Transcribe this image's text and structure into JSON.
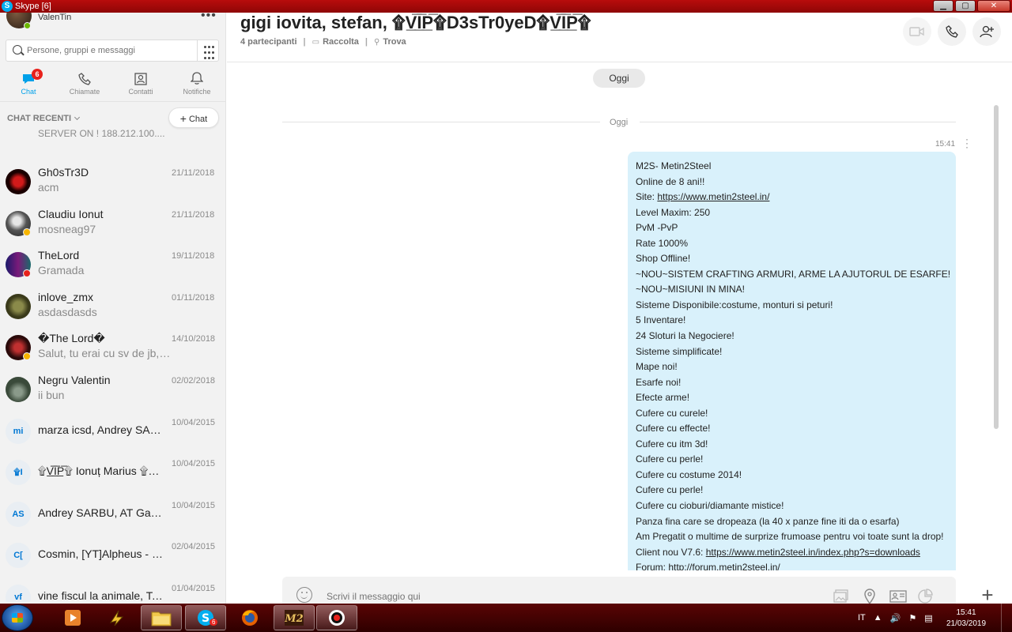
{
  "window": {
    "title": "Skype [6]",
    "icon": "skype-icon",
    "buttons": [
      "minimize",
      "maximize",
      "close"
    ]
  },
  "profile": {
    "name": "ValenTin",
    "presence": "online"
  },
  "search": {
    "placeholder": "Persone, gruppi e messaggi"
  },
  "nav_tabs": [
    {
      "label": "Chat",
      "icon": "chat-icon",
      "badge": "6",
      "active": true
    },
    {
      "label": "Chiamate",
      "icon": "phone-icon"
    },
    {
      "label": "Contatti",
      "icon": "contacts-icon"
    },
    {
      "label": "Notifiche",
      "icon": "bell-icon"
    }
  ],
  "recent": {
    "header": "CHAT RECENTI",
    "new_chat": "Chat"
  },
  "chat_list_cut_text": "SERVER ON ! 188.212.100....",
  "chats": [
    {
      "name": "Gh0sTr3D",
      "msg": "acm",
      "date": "21/11/2018",
      "avatar": "",
      "color": "#8b1010"
    },
    {
      "name": "Claudiu Ionut",
      "msg": "mosneag97",
      "date": "21/11/2018",
      "avatar": "",
      "color": "#5a5a5a",
      "status": "#f7b500"
    },
    {
      "name": "TheLord",
      "msg": "Gramada",
      "date": "19/11/2018",
      "avatar": "",
      "color": "#1a1a4a",
      "status": "#e8221c"
    },
    {
      "name": "inlove_zmx",
      "msg": "asdasdasds",
      "date": "01/11/2018",
      "avatar": "",
      "color": "#4a4a2a"
    },
    {
      "name": "�The Lord�",
      "msg": "Salut, tu erai cu sv de jb, pa...",
      "date": "14/10/2018",
      "avatar": "",
      "color": "#6a1010",
      "status": "#f7b500"
    },
    {
      "name": "Negru Valentin",
      "msg": "ii bun",
      "date": "02/02/2018",
      "avatar": "",
      "color": "#3a4a3a"
    },
    {
      "name": "marza icsd, Andrey SARB...",
      "msg": "",
      "date": "10/04/2015",
      "avatar": "mi"
    },
    {
      "name": "۩V̲̅I̲̅P̲̅۩ Ionuț Marius ۩V̲̅I̲̅P̲̅...",
      "msg": "",
      "date": "10/04/2015",
      "avatar": "۩I"
    },
    {
      "name": "Andrey SARBU, AT GabyRO",
      "msg": "",
      "date": "10/04/2015",
      "avatar": "AS"
    },
    {
      "name": "Cosmin, [YT]Alpheus - Fr...",
      "msg": "",
      "date": "02/04/2015",
      "avatar": "C["
    },
    {
      "name": "vine fiscul la animale, Tof...",
      "msg": "",
      "date": "01/04/2015",
      "avatar": "vf"
    }
  ],
  "conversation": {
    "title": "gigi iovita, stefan, ۩V̲̅I̲̅P̲̅۩D3sTr0yeD۩V̲̅I̲̅P̲̅۩",
    "participants": "4 partecipanti",
    "gallery": "Raccolta",
    "find": "Trova",
    "date_pill": "Oggi",
    "date_separator": "Oggi",
    "message_time": "15:41",
    "composer_placeholder": "Scrivi il messaggio qui"
  },
  "message_lines": [
    "M2S- Metin2Steel",
    "Online de 8 ani!!",
    "Site: https://www.metin2steel.in/",
    "Level Maxim: 250",
    "PvM -PvP",
    "Rate 1000%",
    "Shop Offline!",
    "~NOU~SISTEM CRAFTING ARMURI, ARME LA AJUTORUL DE ESARFE!",
    "~NOU~MISIUNI IN MINA!",
    "Sisteme Disponibile:costume, monturi si peturi!",
    "5 Inventare!",
    "24 Sloturi la Negociere!",
    "Sisteme simplificate!",
    "Mape noi!",
    "Esarfe noi!",
    "Efecte arme!",
    "Cufere cu curele!",
    "Cufere cu effecte!",
    "Cufere cu itm 3d!",
    "Cufere cu perle!",
    "Cufere cu costume 2014!",
    "Cufere cu perle!",
    "Cufere cu cioburi/diamante mistice!",
    "Panza fina care se dropeaza (la 40 x panze fine iti da o esarfa)",
    "Am Pregatit o multime de surprize frumoase pentru voi toate sunt la drop!",
    "Client nou V7.6: https://www.metin2steel.in/index.php?s=downloads",
    "Forum: http://forum.metin2steel.in/"
  ],
  "message_links": {
    "site": "https://www.metin2steel.in/",
    "client": "https://www.metin2steel.in/index.php?s=downloads"
  },
  "taskbar": {
    "apps": [
      "media-player-icon",
      "winamp-icon",
      "explorer-icon",
      "skype-icon",
      "firefox-icon",
      "metin2-icon",
      "recorder-icon"
    ],
    "skype_badge": "6",
    "language": "IT",
    "time": "15:41",
    "date": "21/03/2019"
  },
  "colors": {
    "accent": "#00a1e9",
    "bubble": "#d9f1fb",
    "titlebar": "#b80c0c",
    "taskbar": "#3a0000",
    "badge": "#e8221c"
  }
}
